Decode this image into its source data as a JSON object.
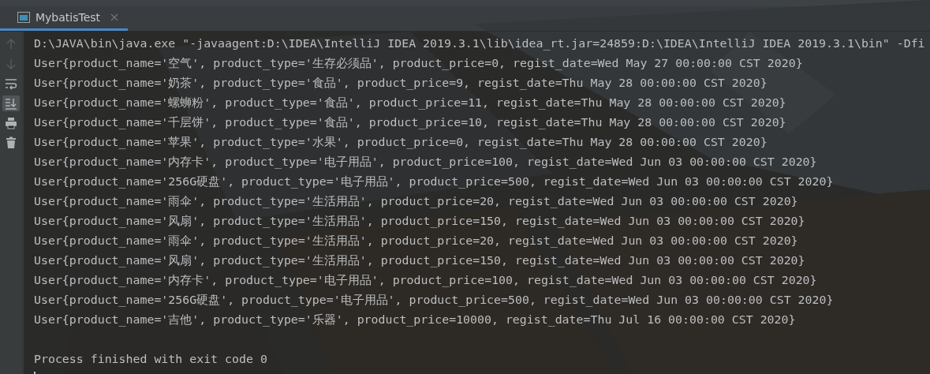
{
  "tab": {
    "label": "MybatisTest",
    "selected": true
  },
  "toolbar": [
    {
      "kind": "up",
      "disabled": true,
      "on": false
    },
    {
      "kind": "down",
      "disabled": true,
      "on": false
    },
    {
      "kind": "wrap",
      "disabled": false,
      "on": false
    },
    {
      "kind": "scroll_end",
      "disabled": false,
      "on": true
    },
    {
      "kind": "print",
      "disabled": false,
      "on": false
    },
    {
      "kind": "trash",
      "disabled": false,
      "on": false
    }
  ],
  "console": {
    "lines": [
      "D:\\JAVA\\bin\\java.exe \"-javaagent:D:\\IDEA\\IntelliJ IDEA 2019.3.1\\lib\\idea_rt.jar=24859:D:\\IDEA\\IntelliJ IDEA 2019.3.1\\bin\" -Dfi",
      "User{product_name='空气', product_type='生存必须品', product_price=0, regist_date=Wed May 27 00:00:00 CST 2020}",
      "User{product_name='奶茶', product_type='食品', product_price=9, regist_date=Thu May 28 00:00:00 CST 2020}",
      "User{product_name='螺蛳粉', product_type='食品', product_price=11, regist_date=Thu May 28 00:00:00 CST 2020}",
      "User{product_name='千层饼', product_type='食品', product_price=10, regist_date=Thu May 28 00:00:00 CST 2020}",
      "User{product_name='苹果', product_type='水果', product_price=0, regist_date=Thu May 28 00:00:00 CST 2020}",
      "User{product_name='内存卡', product_type='电子用品', product_price=100, regist_date=Wed Jun 03 00:00:00 CST 2020}",
      "User{product_name='256G硬盘', product_type='电子用品', product_price=500, regist_date=Wed Jun 03 00:00:00 CST 2020}",
      "User{product_name='雨伞', product_type='生活用品', product_price=20, regist_date=Wed Jun 03 00:00:00 CST 2020}",
      "User{product_name='风扇', product_type='生活用品', product_price=150, regist_date=Wed Jun 03 00:00:00 CST 2020}",
      "User{product_name='雨伞', product_type='生活用品', product_price=20, regist_date=Wed Jun 03 00:00:00 CST 2020}",
      "User{product_name='风扇', product_type='生活用品', product_price=150, regist_date=Wed Jun 03 00:00:00 CST 2020}",
      "User{product_name='内存卡', product_type='电子用品', product_price=100, regist_date=Wed Jun 03 00:00:00 CST 2020}",
      "User{product_name='256G硬盘', product_type='电子用品', product_price=500, regist_date=Wed Jun 03 00:00:00 CST 2020}",
      "User{product_name='吉他', product_type='乐器', product_price=10000, regist_date=Thu Jul 16 00:00:00 CST 2020}"
    ],
    "exit_message": "Process finished with exit code 0"
  }
}
